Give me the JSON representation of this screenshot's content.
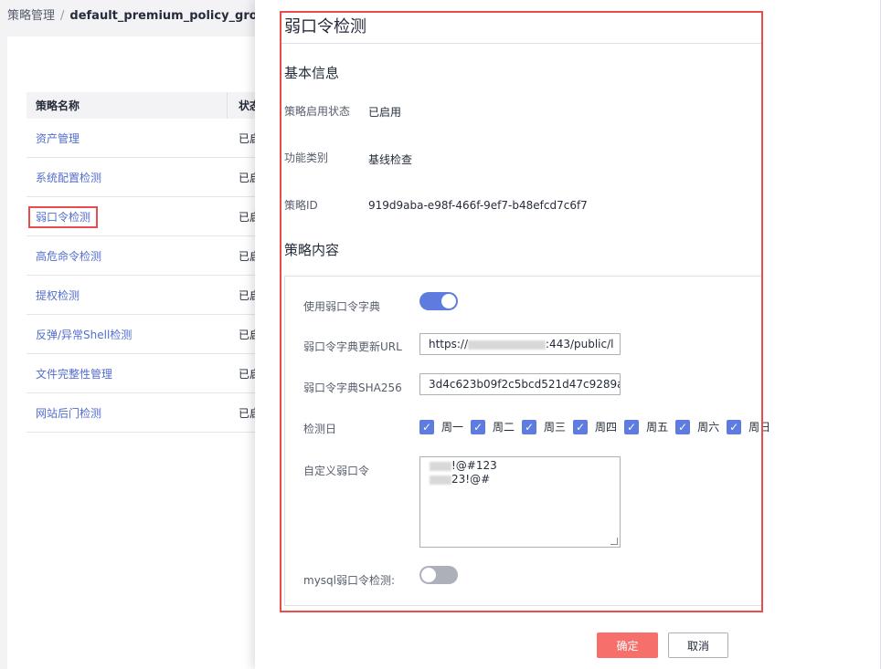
{
  "breadcrumb": {
    "root": "策略管理",
    "separator": "/",
    "current": "default_premium_policy_group"
  },
  "policy_table": {
    "headers": [
      "策略名称",
      "状态"
    ],
    "rows": [
      {
        "name": "资产管理",
        "status": "已启"
      },
      {
        "name": "系统配置检测",
        "status": "已启"
      },
      {
        "name": "弱口令检测",
        "status": "已启"
      },
      {
        "name": "高危命令检测",
        "status": "已启"
      },
      {
        "name": "提权检测",
        "status": "已启"
      },
      {
        "name": "反弹/异常Shell检测",
        "status": "已启"
      },
      {
        "name": "文件完整性管理",
        "status": "已启"
      },
      {
        "name": "网站后门检测",
        "status": "已启"
      }
    ]
  },
  "drawer": {
    "title": "弱口令检测",
    "basic_info_title": "基本信息",
    "info": [
      {
        "label": "策略启用状态",
        "value": "已启用"
      },
      {
        "label": "功能类别",
        "value": "基线检查"
      },
      {
        "label": "策略ID",
        "value": "919d9aba-e98f-466f-9ef7-b48efcd7c6f7"
      }
    ],
    "policy_content_title": "策略内容",
    "use_dict_label": "使用弱口令字典",
    "use_dict_on": true,
    "dict_url_label": "弱口令字典更新URL",
    "dict_url_prefix": "https://",
    "dict_url_suffix": ":443/public/l",
    "dict_sha_label": "弱口令字典SHA256",
    "dict_sha_value": "3d4c623b09f2c5bcd521d47c9289a",
    "check_day_label": "检测日",
    "days": [
      "周一",
      "周二",
      "周三",
      "周四",
      "周五",
      "周六",
      "周日"
    ],
    "custom_label": "自定义弱口令",
    "custom_line1": "!@#123",
    "custom_line2": "23!@#",
    "mysql_label": "mysql弱口令检测:",
    "mysql_on": false
  },
  "buttons": {
    "ok": "确定",
    "cancel": "取消"
  },
  "colors": {
    "accent": "#5e7ce0",
    "danger": "#e84c4c",
    "ok_button": "#f66f6a"
  }
}
